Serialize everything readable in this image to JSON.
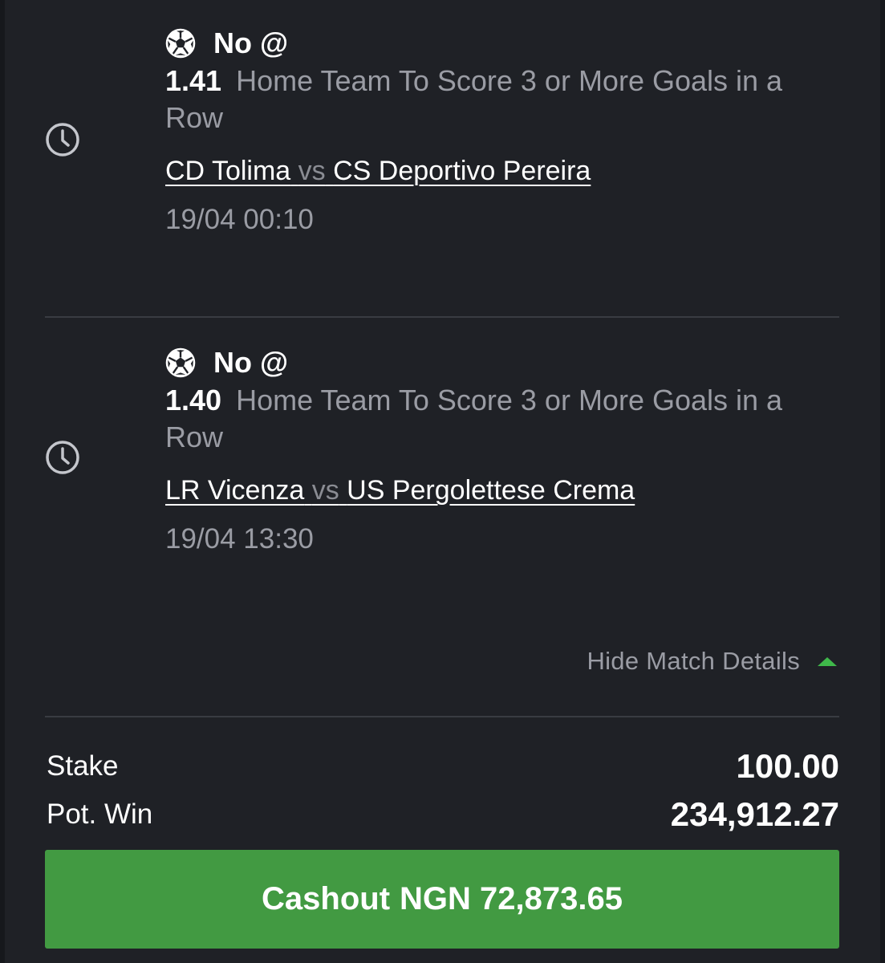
{
  "bets": [
    {
      "pick": "No @",
      "odds": "1.41",
      "market": "Home Team To Score 3 or More Goals in a Row",
      "home_team": "CD Tolima",
      "vs": "vs",
      "away_team": "CS Deportivo Pereira",
      "datetime": "19/04 00:10",
      "status_icon": "clock-icon",
      "sport_icon": "soccer-ball-icon"
    },
    {
      "pick": "No @",
      "odds": "1.40",
      "market": "Home Team To Score 3 or More Goals in a Row",
      "home_team": "LR Vicenza",
      "vs": "vs",
      "away_team": "US Pergolettese Crema",
      "datetime": "19/04 13:30",
      "status_icon": "clock-icon",
      "sport_icon": "soccer-ball-icon"
    }
  ],
  "details_toggle": {
    "label": "Hide Match Details",
    "icon": "caret-up-icon"
  },
  "summary": {
    "stake_label": "Stake",
    "stake_value": "100.00",
    "pot_win_label": "Pot. Win",
    "pot_win_value": "234,912.27"
  },
  "cashout": {
    "label": "Cashout",
    "amount": "NGN 72,873.65"
  },
  "colors": {
    "background": "#1f2126",
    "accent_green": "#429a42",
    "caret_green": "#3fb84a",
    "muted_text": "#9a9ca4"
  }
}
